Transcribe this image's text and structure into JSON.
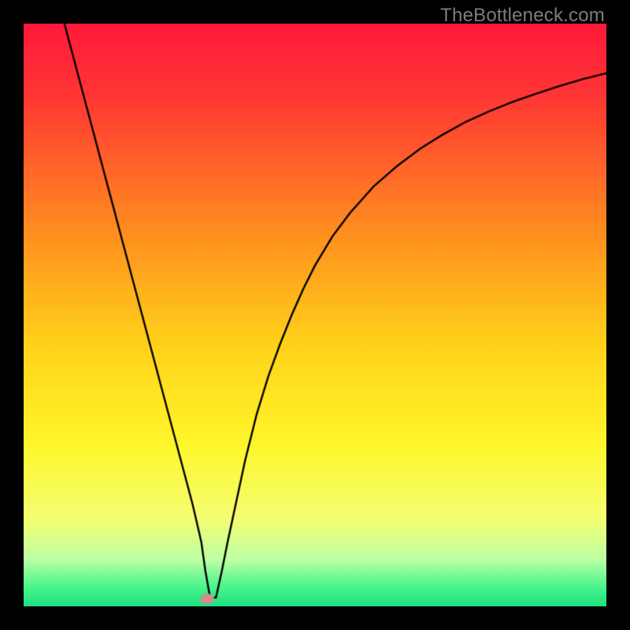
{
  "watermark": {
    "text": "TheBottleneck.com"
  },
  "colors": {
    "frame_bg": "#000000",
    "curve": "#000000",
    "marker_fill": "#cf8f88",
    "gradient_stops": [
      {
        "pos": 0.0,
        "color": "#ff1a3a"
      },
      {
        "pos": 0.12,
        "color": "#ff3535"
      },
      {
        "pos": 0.35,
        "color": "#ff8b20"
      },
      {
        "pos": 0.55,
        "color": "#ffd21a"
      },
      {
        "pos": 0.72,
        "color": "#fff62a"
      },
      {
        "pos": 0.85,
        "color": "#f4ff73"
      },
      {
        "pos": 0.92,
        "color": "#bdffa4"
      },
      {
        "pos": 0.965,
        "color": "#4cf58e"
      },
      {
        "pos": 1.0,
        "color": "#1ee07e"
      }
    ]
  },
  "chart_data": {
    "type": "line",
    "title": "",
    "xlabel": "",
    "ylabel": "",
    "xlim": [
      0,
      100
    ],
    "ylim": [
      0,
      100
    ],
    "grid": false,
    "series": [
      {
        "name": "bottleneck-curve",
        "x": [
          7,
          9,
          11,
          13,
          15,
          17,
          19,
          21,
          23,
          25,
          27,
          29,
          30.5,
          31.2,
          32,
          33,
          34,
          35,
          36.5,
          38,
          40,
          42,
          44,
          46,
          48,
          50,
          53,
          56,
          60,
          64,
          68,
          72,
          76,
          80,
          84,
          88,
          92,
          96,
          100
        ],
        "y": [
          100,
          92.5,
          85,
          77.5,
          70,
          62.5,
          55,
          47.5,
          40,
          32.5,
          25,
          17.5,
          11,
          6,
          1.5,
          1.5,
          6,
          11,
          18,
          25,
          33,
          39.5,
          45,
          50,
          54.5,
          58.5,
          63.5,
          67.5,
          72,
          75.5,
          78.5,
          81,
          83.2,
          85,
          86.6,
          88,
          89.3,
          90.5,
          91.5
        ]
      }
    ],
    "marker": {
      "x": 31.5,
      "y": 1.3,
      "rx": 1.2,
      "ry": 0.9
    }
  }
}
